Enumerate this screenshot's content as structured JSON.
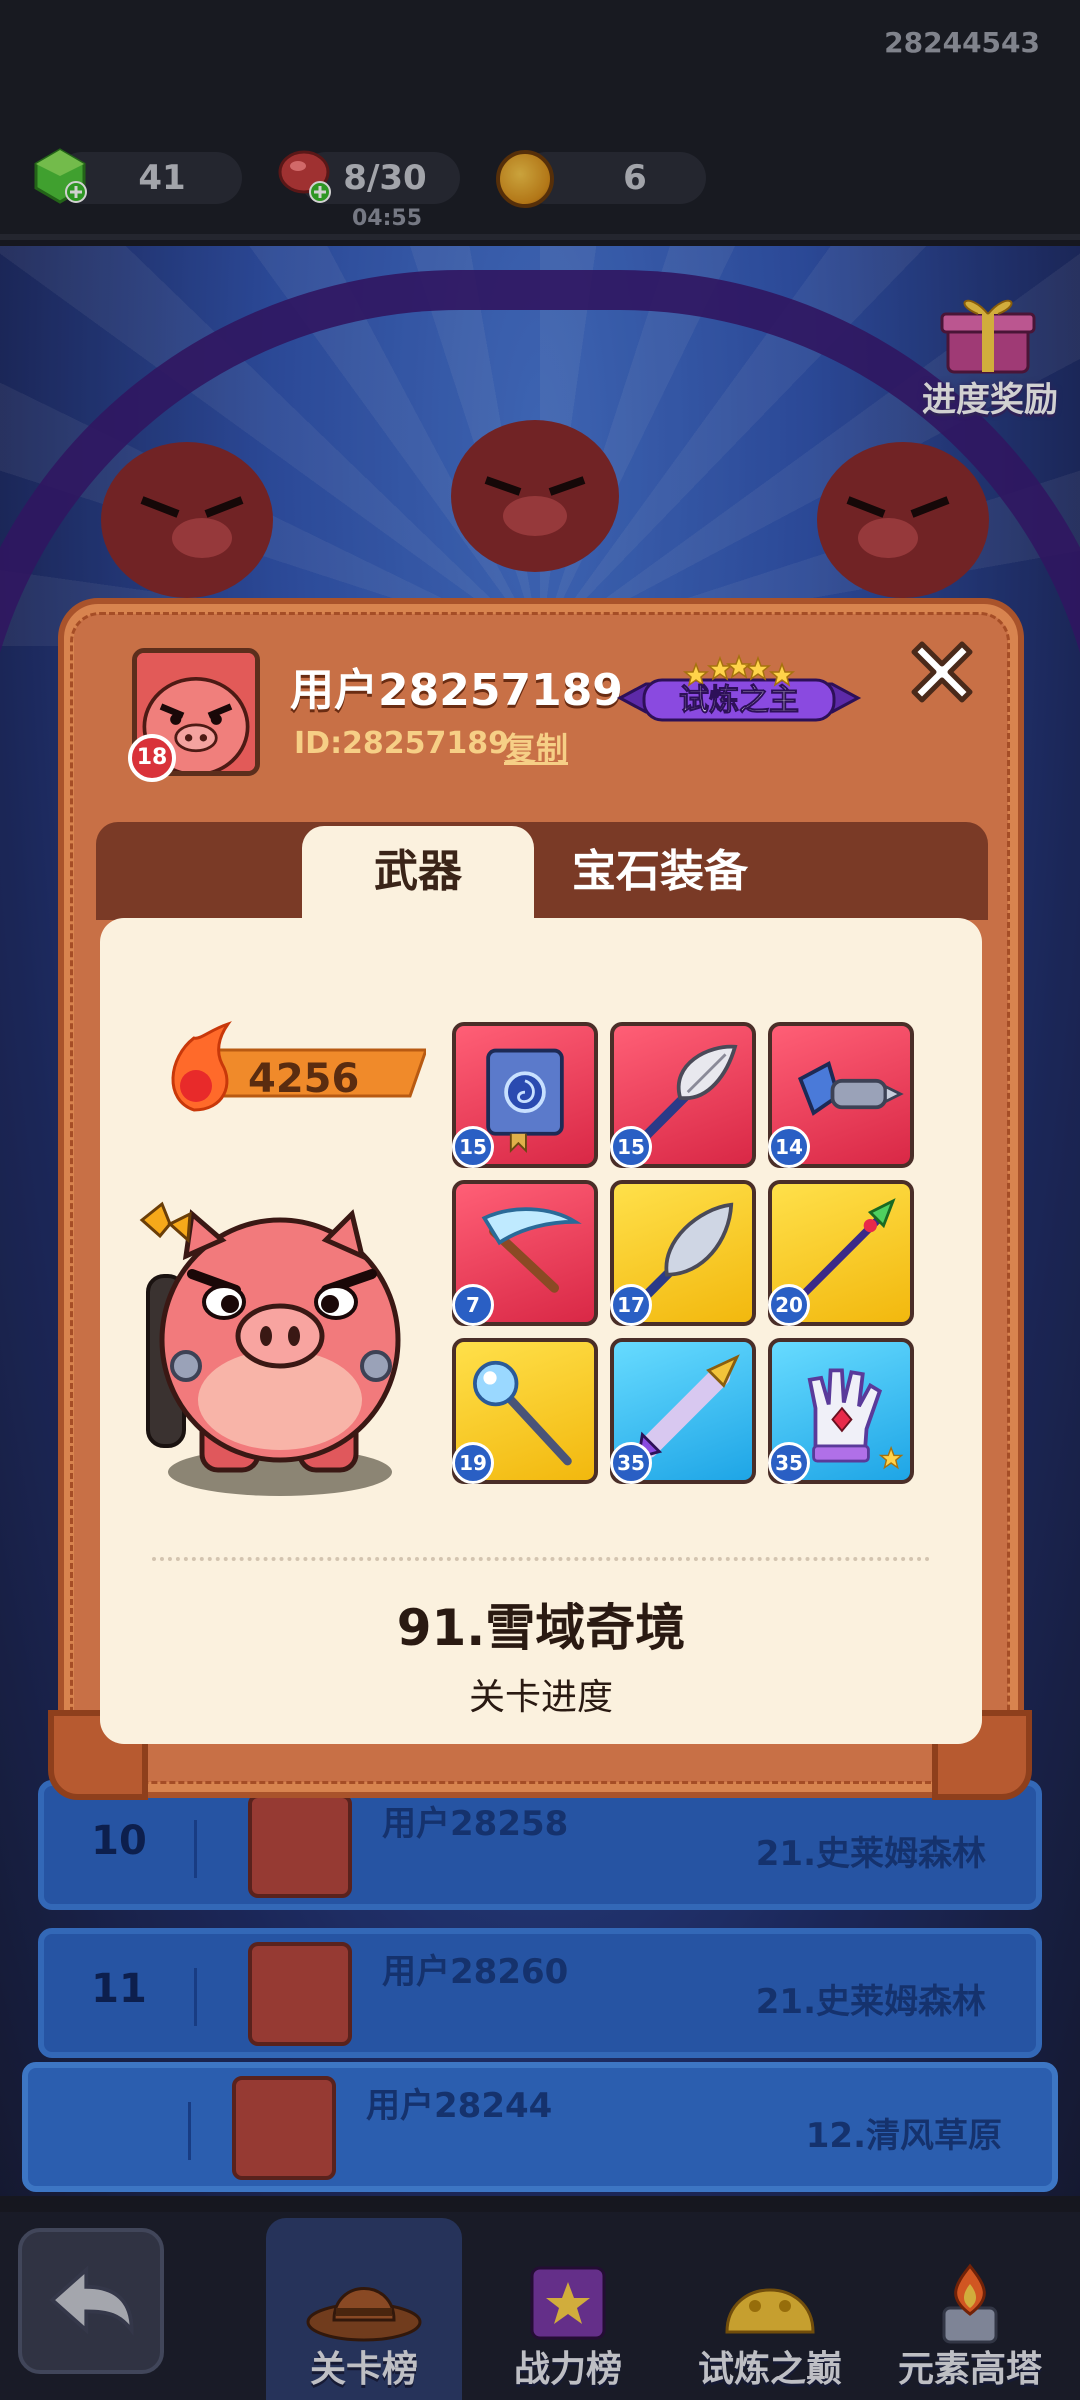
{
  "top_bar": {
    "user_id": "28244543",
    "gems": "41",
    "stamina": "8/30",
    "stamina_timer": "04:55",
    "coins": "6"
  },
  "background": {
    "progress_reward_label": "进度奖励"
  },
  "ranking": [
    {
      "rank": "10",
      "name": "用户28258",
      "level": "21.史莱姆森林"
    },
    {
      "rank": "11",
      "name": "用户28260",
      "level": "21.史莱姆森林"
    },
    {
      "rank": "",
      "name": "用户28244",
      "level": "12.清风草原"
    }
  ],
  "popup": {
    "player_name": "用户28257189",
    "player_id": "ID:28257189",
    "copy_label": "复制",
    "player_level": "18",
    "title_badge": "试炼之主",
    "tabs": [
      "武器",
      "宝石装备"
    ],
    "power": "4256",
    "weapons": [
      {
        "level": "15",
        "rarity": "red",
        "icon": "spellbook-icon"
      },
      {
        "level": "15",
        "rarity": "red",
        "icon": "feather-staff-icon"
      },
      {
        "level": "14",
        "rarity": "red",
        "icon": "drill-gauntlet-icon"
      },
      {
        "level": "7",
        "rarity": "red",
        "icon": "ice-pickaxe-icon"
      },
      {
        "level": "17",
        "rarity": "yellow",
        "icon": "feather-blade-icon"
      },
      {
        "level": "20",
        "rarity": "yellow",
        "icon": "green-spear-icon"
      },
      {
        "level": "19",
        "rarity": "yellow",
        "icon": "crystal-staff-icon"
      },
      {
        "level": "35",
        "rarity": "blue",
        "icon": "drill-lance-icon"
      },
      {
        "level": "35",
        "rarity": "blue",
        "icon": "magic-glove-icon"
      }
    ],
    "stage_name": "91.雪域奇境",
    "stage_label": "关卡进度"
  },
  "nav": {
    "tabs": [
      "关卡榜",
      "战力榜",
      "试炼之巅",
      "元素高塔"
    ]
  }
}
